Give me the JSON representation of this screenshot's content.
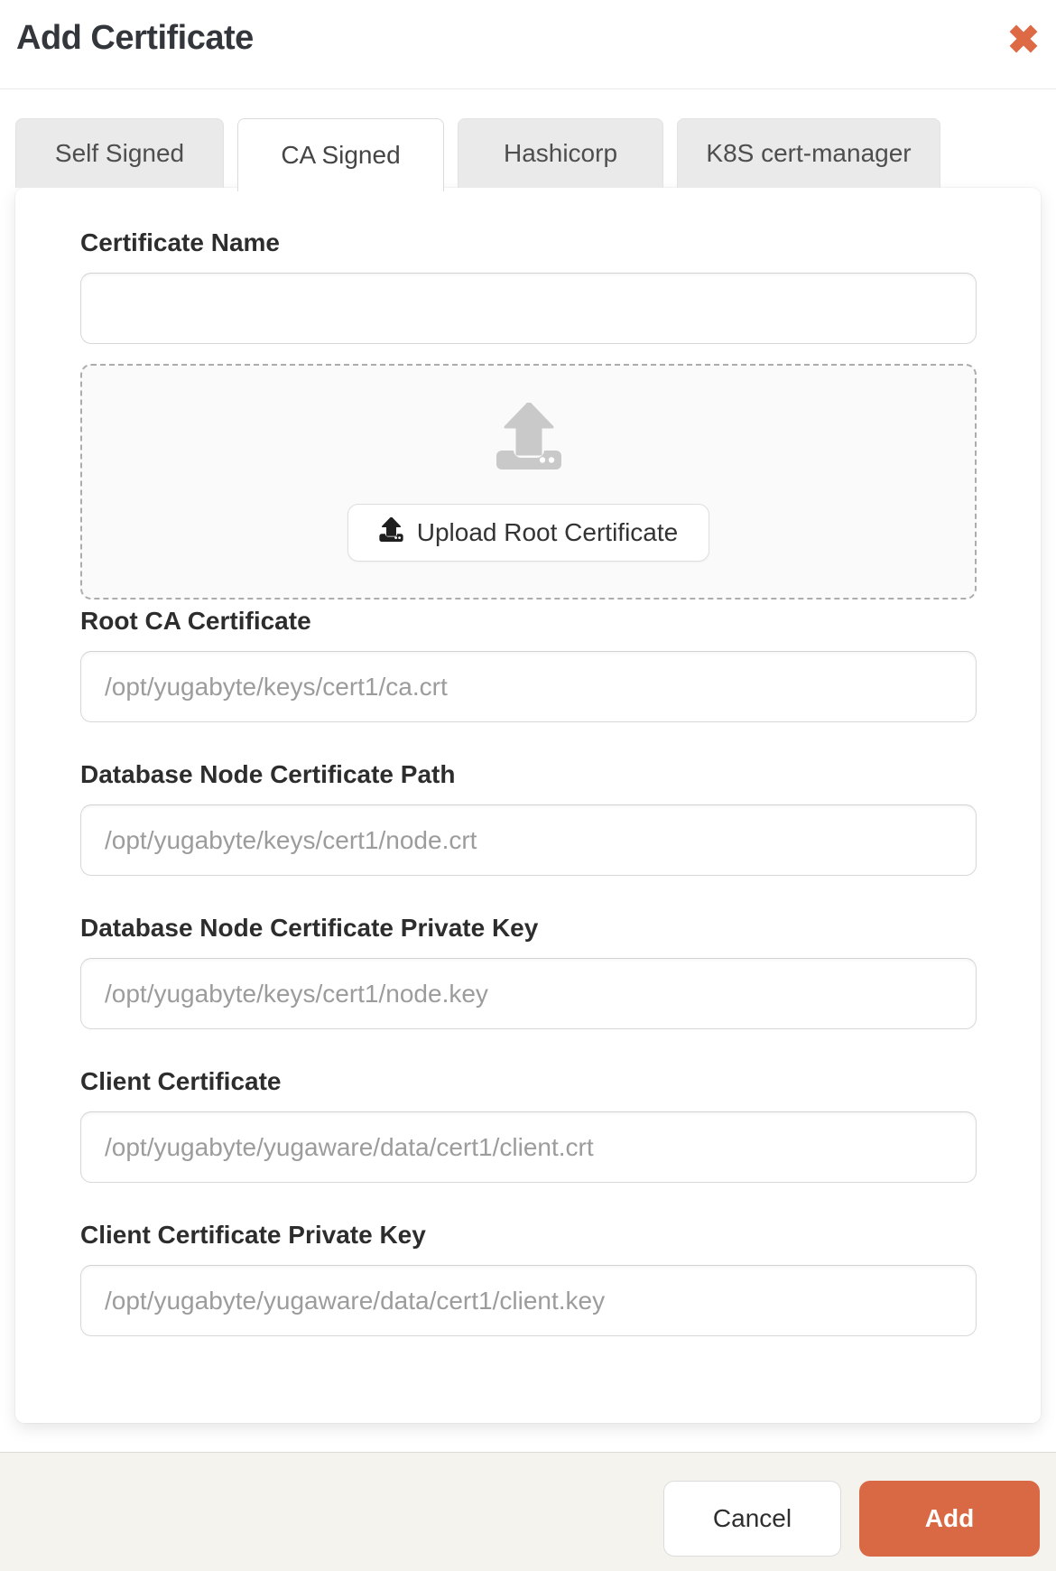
{
  "modal": {
    "title": "Add Certificate"
  },
  "tabs": [
    {
      "label": "Self Signed",
      "active": false
    },
    {
      "label": "CA Signed",
      "active": true
    },
    {
      "label": "Hashicorp",
      "active": false
    },
    {
      "label": "K8S cert-manager",
      "active": false
    }
  ],
  "form": {
    "fields": [
      {
        "label": "Certificate Name",
        "value": "",
        "placeholder": ""
      },
      {
        "label": "Root CA Certificate",
        "value": "",
        "placeholder": "/opt/yugabyte/keys/cert1/ca.crt"
      },
      {
        "label": "Database Node Certificate Path",
        "value": "",
        "placeholder": "/opt/yugabyte/keys/cert1/node.crt"
      },
      {
        "label": "Database Node Certificate Private Key",
        "value": "",
        "placeholder": "/opt/yugabyte/keys/cert1/node.key"
      },
      {
        "label": "Client Certificate",
        "value": "",
        "placeholder": "/opt/yugabyte/yugaware/data/cert1/client.crt"
      },
      {
        "label": "Client Certificate Private Key",
        "value": "",
        "placeholder": "/opt/yugabyte/yugaware/data/cert1/client.key"
      }
    ],
    "upload": {
      "button_label": "Upload Root Certificate",
      "zone_icon": "upload-tray-icon",
      "button_icon": "upload-icon"
    }
  },
  "footer": {
    "cancel_label": "Cancel",
    "add_label": "Add"
  },
  "colors": {
    "accent_orange": "#D96944",
    "close_orange": "#DE6A45",
    "footer_bg": "#F4F3EE",
    "tab_inactive_bg": "#EAEAEA",
    "panel_bg": "#FFFFFF",
    "label_text": "#2D2D2D",
    "placeholder_text": "#9C9C9C",
    "upload_icon_gray": "#C9C9C9"
  }
}
